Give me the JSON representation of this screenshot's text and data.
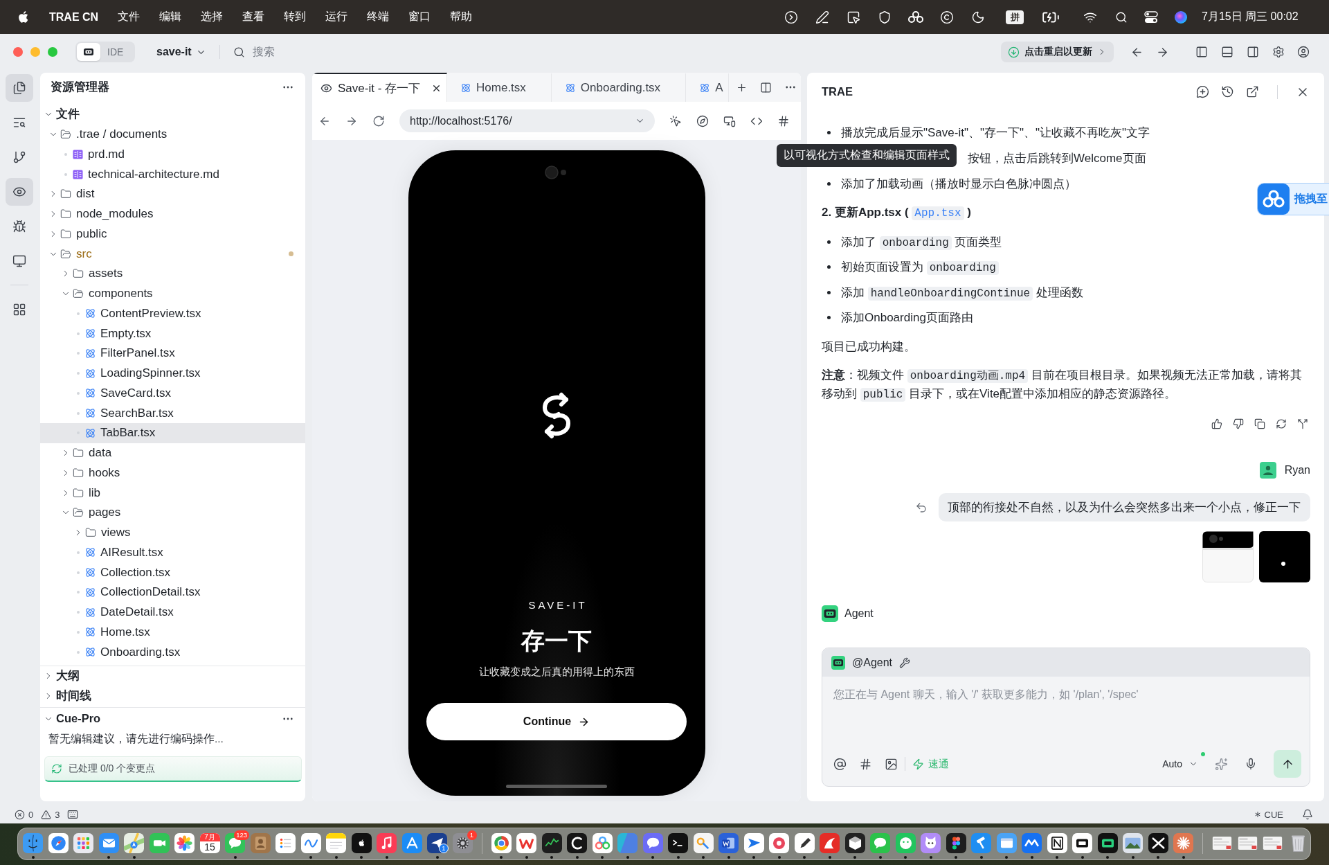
{
  "menu_bar": {
    "app_name": "TRAE CN",
    "menus": [
      "文件",
      "编辑",
      "选择",
      "查看",
      "转到",
      "运行",
      "终端",
      "窗口",
      "帮助"
    ],
    "input_method": "拼",
    "clock": "7月15日 周三 00:02"
  },
  "toolbar": {
    "modes": [
      {
        "kind": "solo",
        "selected": true
      },
      {
        "kind": "ide",
        "label": "IDE",
        "selected": false
      }
    ],
    "project": "save-it",
    "search": {
      "placeholder": "搜索"
    },
    "update_button": "点击重启以更新"
  },
  "activity_bar": [
    {
      "kind": "files",
      "selected": true
    },
    {
      "kind": "search",
      "selected": false
    },
    {
      "kind": "branch",
      "selected": false
    },
    {
      "kind": "preview",
      "selected": true
    },
    {
      "kind": "debug",
      "selected": false
    },
    {
      "kind": "remote",
      "selected": false
    },
    {
      "kind": "extensions",
      "selected": false
    }
  ],
  "explorer": {
    "title": "资源管理器",
    "files_section": {
      "label": "文件",
      "expanded": true
    },
    "tree": [
      {
        "name": ".trae / documents",
        "kind": "folder",
        "expanded": true,
        "selected": false,
        "modified": false,
        "children": [
          {
            "name": "prd.md",
            "kind": "markdown",
            "selected": false,
            "modified": false
          },
          {
            "name": "technical-architecture.md",
            "kind": "markdown",
            "selected": false,
            "modified": false
          }
        ]
      },
      {
        "name": "dist",
        "kind": "folder",
        "expanded": false,
        "selected": false,
        "modified": false
      },
      {
        "name": "node_modules",
        "kind": "folder",
        "expanded": false,
        "selected": false,
        "modified": false
      },
      {
        "name": "public",
        "kind": "folder",
        "expanded": false,
        "selected": false,
        "modified": false
      },
      {
        "name": "src",
        "kind": "folder",
        "expanded": true,
        "selected": false,
        "modified": true,
        "children": [
          {
            "name": "assets",
            "kind": "folder",
            "expanded": false,
            "selected": false,
            "modified": false
          },
          {
            "name": "components",
            "kind": "folder",
            "expanded": true,
            "selected": false,
            "modified": false,
            "children": [
              {
                "name": "ContentPreview.tsx",
                "kind": "react",
                "selected": false,
                "modified": false
              },
              {
                "name": "Empty.tsx",
                "kind": "react",
                "selected": false,
                "modified": false
              },
              {
                "name": "FilterPanel.tsx",
                "kind": "react",
                "selected": false,
                "modified": false
              },
              {
                "name": "LoadingSpinner.tsx",
                "kind": "react",
                "selected": false,
                "modified": false
              },
              {
                "name": "SaveCard.tsx",
                "kind": "react",
                "selected": false,
                "modified": false
              },
              {
                "name": "SearchBar.tsx",
                "kind": "react",
                "selected": false,
                "modified": false
              },
              {
                "name": "TabBar.tsx",
                "kind": "react",
                "selected": true,
                "modified": false
              }
            ]
          },
          {
            "name": "data",
            "kind": "folder",
            "expanded": false,
            "selected": false,
            "modified": false
          },
          {
            "name": "hooks",
            "kind": "folder",
            "expanded": false,
            "selected": false,
            "modified": false
          },
          {
            "name": "lib",
            "kind": "folder",
            "expanded": false,
            "selected": false,
            "modified": false
          },
          {
            "name": "pages",
            "kind": "folder",
            "expanded": true,
            "selected": false,
            "modified": false,
            "children": [
              {
                "name": "views",
                "kind": "folder",
                "expanded": false,
                "selected": false,
                "modified": false
              },
              {
                "name": "AIResult.tsx",
                "kind": "react",
                "selected": false,
                "modified": false
              },
              {
                "name": "Collection.tsx",
                "kind": "react",
                "selected": false,
                "modified": false
              },
              {
                "name": "CollectionDetail.tsx",
                "kind": "react",
                "selected": false,
                "modified": false
              },
              {
                "name": "DateDetail.tsx",
                "kind": "react",
                "selected": false,
                "modified": false
              },
              {
                "name": "Home.tsx",
                "kind": "react",
                "selected": false,
                "modified": false
              },
              {
                "name": "Onboarding.tsx",
                "kind": "react",
                "selected": false,
                "modified": false
              }
            ]
          }
        ]
      }
    ],
    "sections": [
      {
        "label": "大纲",
        "expanded": false
      },
      {
        "label": "时间线",
        "expanded": false
      }
    ],
    "cue_pro": {
      "title": "Cue-Pro",
      "expanded": true,
      "message": "暂无编辑建议，请先进行编码操作...",
      "status": "已处理 0/0 个变更点"
    }
  },
  "editor": {
    "tabs": [
      {
        "label": "Save-it - 存一下",
        "kind": "preview",
        "selected": true
      },
      {
        "label": "Home.tsx",
        "kind": "react",
        "selected": false
      },
      {
        "label": "Onboarding.tsx",
        "kind": "react",
        "selected": false
      },
      {
        "label": "A",
        "kind": "react",
        "selected": false
      }
    ],
    "address": {
      "url": "http://localhost:5176/"
    },
    "tooltip": "以可视化方式检查和编辑页面样式",
    "preview": {
      "brand": "SAVE-IT",
      "title": "存一下",
      "subtitle": "让收藏变成之后真的用得上的东西",
      "button": "Continue"
    }
  },
  "chat": {
    "title": "TRAE",
    "reply": [
      {
        "kind": "bullet",
        "segments": [
          {
            "kind": "text",
            "text": "播放完成后显示\"Save-it\"、\"存一下\"、\"让收藏不再吃灰\"文字"
          }
        ]
      },
      {
        "kind": "covered",
        "segments": [
          {
            "kind": "text",
            "text": "按钮，点击后跳转到Welcome页面"
          }
        ]
      },
      {
        "kind": "bullet",
        "segments": [
          {
            "kind": "text",
            "text": "添加了加载动画（播放时显示白色脉冲圆点）"
          }
        ]
      },
      {
        "kind": "heading",
        "segments": [
          {
            "kind": "text",
            "text": "2. 更新App.tsx ( "
          },
          {
            "kind": "link",
            "text": "App.tsx"
          },
          {
            "kind": "text",
            "text": " )"
          }
        ]
      },
      {
        "kind": "bullet",
        "segments": [
          {
            "kind": "text",
            "text": "添加了 "
          },
          {
            "kind": "code",
            "text": "onboarding"
          },
          {
            "kind": "text",
            "text": " 页面类型"
          }
        ]
      },
      {
        "kind": "bullet",
        "segments": [
          {
            "kind": "text",
            "text": "初始页面设置为 "
          },
          {
            "kind": "code",
            "text": "onboarding"
          }
        ]
      },
      {
        "kind": "bullet",
        "segments": [
          {
            "kind": "text",
            "text": "添加 "
          },
          {
            "kind": "code",
            "text": "handleOnboardingContinue"
          },
          {
            "kind": "text",
            "text": " 处理函数"
          }
        ]
      },
      {
        "kind": "bullet",
        "segments": [
          {
            "kind": "text",
            "text": "添加Onboarding页面路由"
          }
        ]
      },
      {
        "kind": "paragraph",
        "segments": [
          {
            "kind": "text",
            "text": "项目已成功构建。"
          }
        ]
      },
      {
        "kind": "paragraph",
        "segments": [
          {
            "kind": "text",
            "text": "**注意**：视频文件 "
          },
          {
            "kind": "code",
            "text": "onboarding动画.mp4"
          },
          {
            "kind": "text",
            "text": " 目前在项目根目录。如果视频无法正常加载，请将其移动到 "
          },
          {
            "kind": "code",
            "text": "public"
          },
          {
            "kind": "text",
            "text": " 目录下，或在Vite配置中添加相应的静态资源路径。"
          }
        ]
      }
    ],
    "user_message": {
      "author": "Ryan",
      "text": "顶部的衔接处不自然，以及为什么会突然多出来一个小点，修正一下"
    },
    "agent": {
      "name": "Agent"
    },
    "composer": {
      "mention": "@Agent",
      "placeholder": "您正在与 Agent 聊天，输入 '/' 获取更多能力，如 '/plan', '/spec'",
      "mode": "速通",
      "model": "Auto"
    }
  },
  "floating_widget": {
    "label": "拖拽至"
  },
  "status_bar": {
    "errors": "0",
    "warnings": "3",
    "cue": "CUE"
  },
  "dock": {
    "apps": [
      {
        "running": true
      },
      {
        "running": false
      },
      {
        "running": false
      },
      {
        "running": true
      },
      {
        "running": true
      },
      {
        "running": false
      },
      {
        "running": false
      },
      {
        "running": false,
        "month": "7月",
        "label": "15"
      },
      {
        "running": true,
        "badge": {
          "text": "123",
          "kind": "alert"
        }
      },
      {
        "running": false
      },
      {
        "running": false
      },
      {
        "running": true
      },
      {
        "running": true
      },
      {
        "running": true
      },
      {
        "running": true
      },
      {
        "running": false
      },
      {
        "running": true,
        "badge": {
          "text": "1",
          "kind": "corner"
        }
      },
      {
        "running": false,
        "badge": {
          "text": "1",
          "kind": "alert"
        }
      },
      {
        "running": true
      },
      {
        "running": true
      },
      {
        "running": true
      },
      {
        "running": true
      },
      {
        "running": true
      },
      {
        "running": true
      },
      {
        "running": true
      },
      {
        "running": true
      },
      {
        "running": true
      },
      {
        "running": true
      },
      {
        "running": true
      },
      {
        "running": true
      },
      {
        "running": true
      },
      {
        "running": true
      },
      {
        "running": true
      },
      {
        "running": true
      },
      {
        "running": true
      },
      {
        "running": true
      },
      {
        "running": true
      },
      {
        "running": true
      },
      {
        "running": true
      },
      {
        "running": true
      },
      {
        "running": true
      },
      {
        "running": true
      },
      {
        "running": true
      },
      {
        "running": true
      },
      {
        "running": true
      },
      {
        "running": true
      },
      {
        "running": false
      },
      {
        "running": false
      },
      {
        "running": false
      },
      {
        "running": false
      }
    ]
  }
}
